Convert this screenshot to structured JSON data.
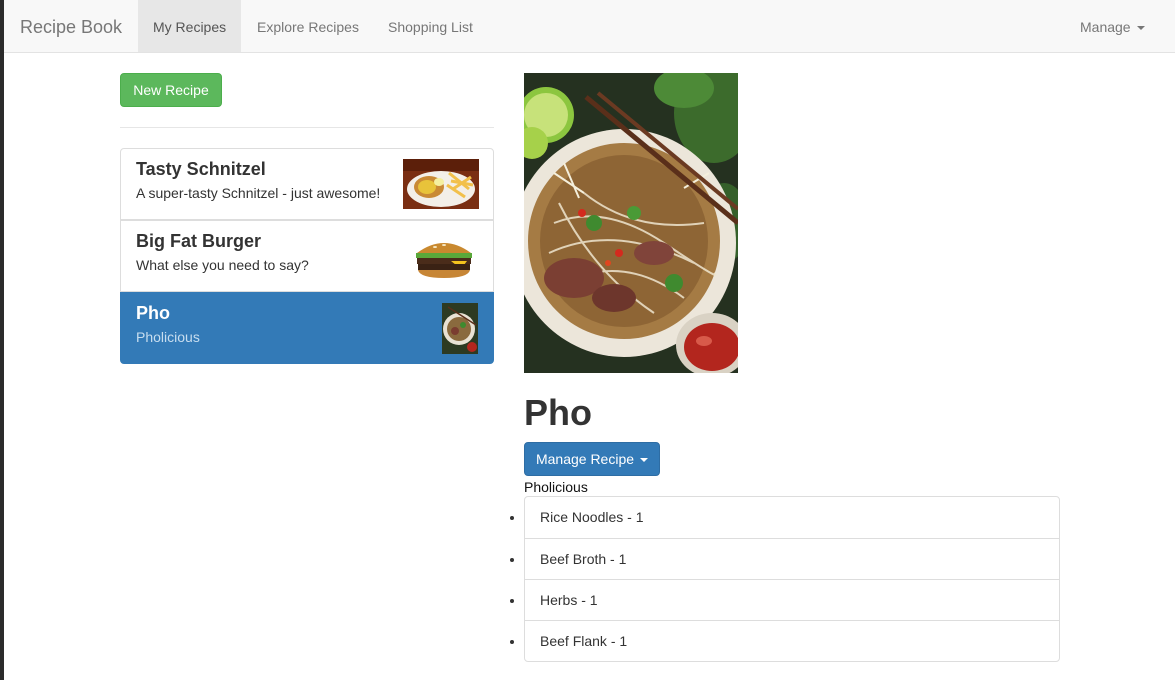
{
  "navbar": {
    "brand": "Recipe Book",
    "tabs": [
      {
        "label": "My Recipes",
        "active": true
      },
      {
        "label": "Explore Recipes",
        "active": false
      },
      {
        "label": "Shopping List",
        "active": false
      }
    ],
    "manage_label": "Manage"
  },
  "sidebar": {
    "new_recipe_label": "New Recipe",
    "recipes": [
      {
        "name": "Tasty Schnitzel",
        "description": "A super-tasty Schnitzel - just awesome!",
        "active": false,
        "image": "schnitzel-photo"
      },
      {
        "name": "Big Fat Burger",
        "description": "What else you need to say?",
        "active": false,
        "image": "burger-photo"
      },
      {
        "name": "Pho",
        "description": "Pholicious",
        "active": true,
        "image": "pho-photo"
      }
    ]
  },
  "detail": {
    "image": "pho-photo",
    "title": "Pho",
    "manage_label": "Manage Recipe",
    "description": "Pholicious",
    "ingredients": [
      "Rice Noodles - 1",
      "Beef Broth - 1",
      "Herbs - 1",
      "Beef Flank - 1"
    ]
  },
  "colors": {
    "primary": "#337ab7",
    "success": "#5cb85c",
    "navbar_bg": "#f8f8f8",
    "active_tab_bg": "#e7e7e7"
  }
}
